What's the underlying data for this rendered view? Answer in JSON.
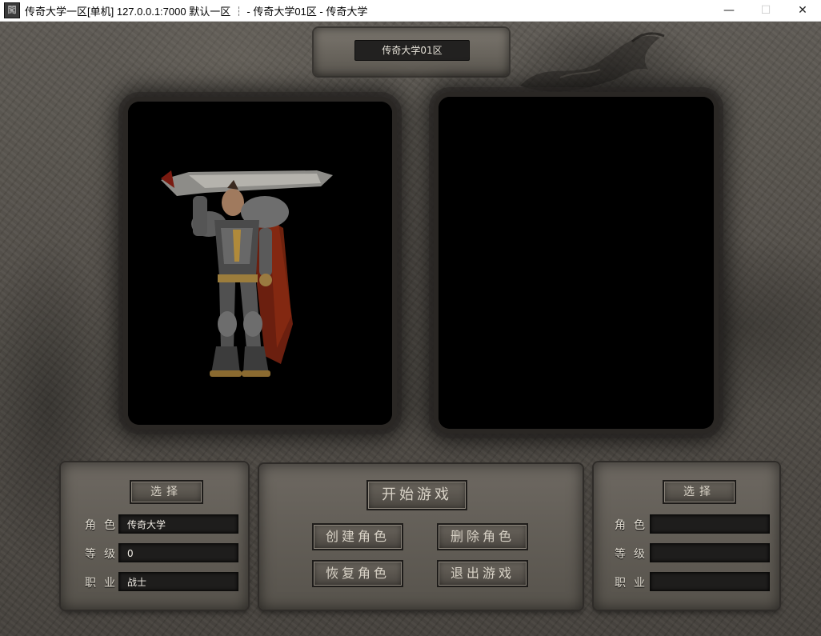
{
  "window": {
    "icon_label": "闖",
    "title": "传奇大学一区[单机] 127.0.0.1:7000  默认一区 ┆ - 传奇大学01区 - 传奇大学",
    "minimize": "—",
    "maximize": "☐",
    "close": "✕"
  },
  "server": {
    "name": "传奇大学01区"
  },
  "left_slot": {
    "select_label": "选择",
    "fields": [
      {
        "label": "角色",
        "value": "传奇大学"
      },
      {
        "label": "等级",
        "value": "0"
      },
      {
        "label": "职业",
        "value": "战士"
      }
    ]
  },
  "right_slot": {
    "select_label": "选择",
    "fields": [
      {
        "label": "角色",
        "value": ""
      },
      {
        "label": "等级",
        "value": ""
      },
      {
        "label": "职业",
        "value": ""
      }
    ]
  },
  "actions": {
    "start_game": "开始游戏",
    "create_character": "创建角色",
    "delete_character": "删除角色",
    "restore_character": "恢复角色",
    "exit_game": "退出游戏"
  },
  "colors": {
    "stone": "#57534c",
    "slot": "#000000",
    "text": "#e2ddd2"
  }
}
